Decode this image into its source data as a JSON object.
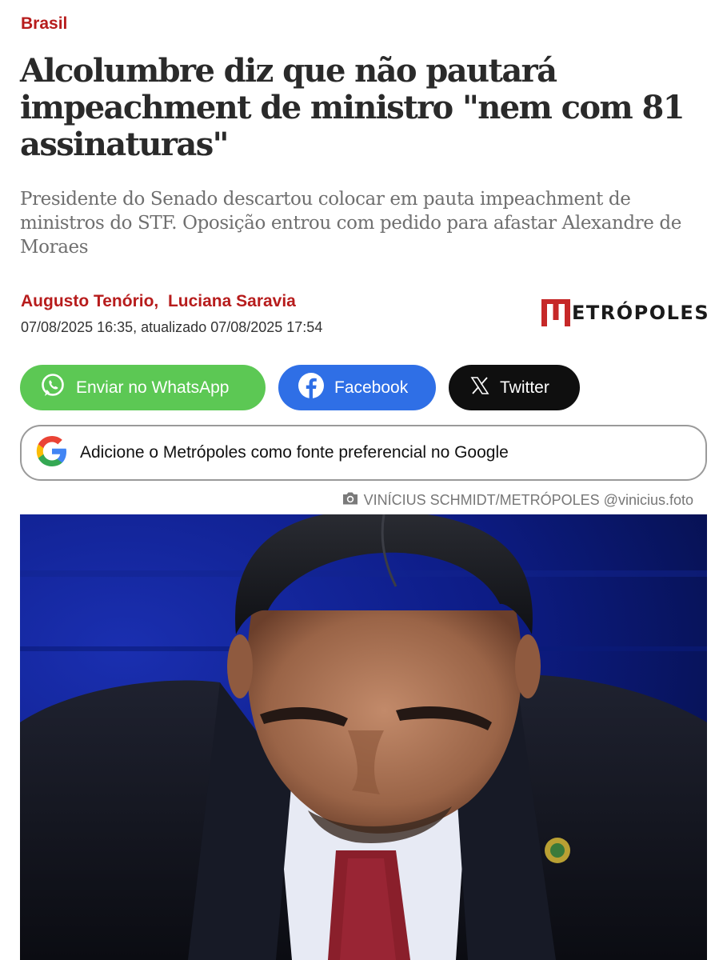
{
  "article": {
    "category": "Brasil",
    "headline": "Alcolumbre diz que não pautará impeachment de ministro \"nem com 81 assinaturas\"",
    "subtitle": "Presidente do Senado descartou colocar em pauta impeachment de ministros do STF. Oposição entrou com pedido para afastar Alexandre de Moraes",
    "authors": [
      {
        "name": "Augusto Tenório"
      },
      {
        "name": "Luciana Saravia"
      }
    ],
    "author_separator": ",",
    "dates": "07/08/2025 16:35, atualizado 07/08/2025 17:54"
  },
  "brand": {
    "logo_text": "ETRÓPOLES",
    "logo_color": "#c62828"
  },
  "share": {
    "whatsapp": {
      "label": "Enviar no WhatsApp",
      "icon": "whatsapp-icon",
      "color": "#5cc854"
    },
    "facebook": {
      "label": "Facebook",
      "icon": "facebook-icon",
      "color": "#2f6fe6"
    },
    "twitter": {
      "label": "Twitter",
      "icon": "x-icon",
      "color": "#0f0f0f"
    }
  },
  "google_pref": {
    "label": "Adicione o Metrópoles como fonte preferencial no Google",
    "icon": "google-icon"
  },
  "photo": {
    "icon": "camera-icon",
    "credit": "VINÍCIUS SCHMIDT/METRÓPOLES @vinicius.foto"
  },
  "colors": {
    "accent": "#b71c1c",
    "headline": "#2a2a2a",
    "subtitle": "#6f6f6f"
  }
}
